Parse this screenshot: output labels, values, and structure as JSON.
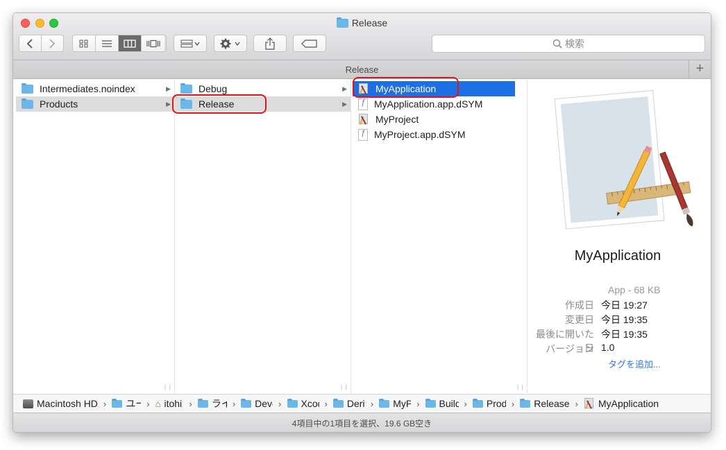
{
  "window": {
    "title": "Release"
  },
  "toolbar": {
    "back_icon": "chevron-left-icon",
    "forward_icon": "chevron-right-icon",
    "view_modes": [
      "icon-view",
      "list-view",
      "column-view",
      "cover-flow-view"
    ],
    "active_view": "column-view",
    "search_placeholder": "検索"
  },
  "tabbar": {
    "title": "Release",
    "add_tab": "+"
  },
  "columns": [
    {
      "items": [
        {
          "name": "Intermediates.noindex",
          "icon": "folder-icon",
          "has_children": true,
          "selected": false
        },
        {
          "name": "Products",
          "icon": "folder-icon",
          "has_children": true,
          "selected": true
        }
      ]
    },
    {
      "items": [
        {
          "name": "Debug",
          "icon": "folder-icon",
          "has_children": true,
          "selected": false
        },
        {
          "name": "Release",
          "icon": "folder-icon",
          "has_children": true,
          "selected": true
        }
      ]
    },
    {
      "items": [
        {
          "name": "MyApplication",
          "icon": "app-icon",
          "selected": true
        },
        {
          "name": "MyApplication.app.dSYM",
          "icon": "dsym-file-icon",
          "selected": false
        },
        {
          "name": "MyProject",
          "icon": "app-icon",
          "selected": false
        },
        {
          "name": "MyProject.app.dSYM",
          "icon": "dsym-file-icon",
          "selected": false
        }
      ]
    }
  ],
  "preview": {
    "name": "MyApplication",
    "kind": "App - 68 KB",
    "rows": [
      {
        "label": "作成日",
        "value": "今日 19:27"
      },
      {
        "label": "変更日",
        "value": "今日 19:35"
      },
      {
        "label": "最後に開いた日",
        "value": "今日 19:35"
      },
      {
        "label": "バージョン",
        "value": "1.0"
      }
    ],
    "add_tags": "タグを追加..."
  },
  "pathbar": [
    {
      "label": "Macintosh HD",
      "icon": "hard-drive-icon"
    },
    {
      "label": "ユーザ",
      "icon": "users-folder-icon"
    },
    {
      "label": "itohi",
      "icon": "home-icon"
    },
    {
      "label": "ライブラリ",
      "icon": "folder-icon"
    },
    {
      "label": "Developer",
      "icon": "folder-icon"
    },
    {
      "label": "Xcode",
      "icon": "folder-icon"
    },
    {
      "label": "DerivedData",
      "icon": "folder-icon"
    },
    {
      "label": "MyProject",
      "icon": "folder-icon"
    },
    {
      "label": "Build",
      "icon": "folder-icon"
    },
    {
      "label": "Products",
      "icon": "folder-icon"
    },
    {
      "label": "Release",
      "icon": "folder-icon"
    },
    {
      "label": "MyApplication",
      "icon": "app-icon"
    }
  ],
  "status": "4項目中の1項目を選択、19.6 GB空き",
  "colors": {
    "selection_blue": "#1d6fe3",
    "annotation_red": "#e2141b",
    "folder_blue": "#6bb7ea"
  }
}
